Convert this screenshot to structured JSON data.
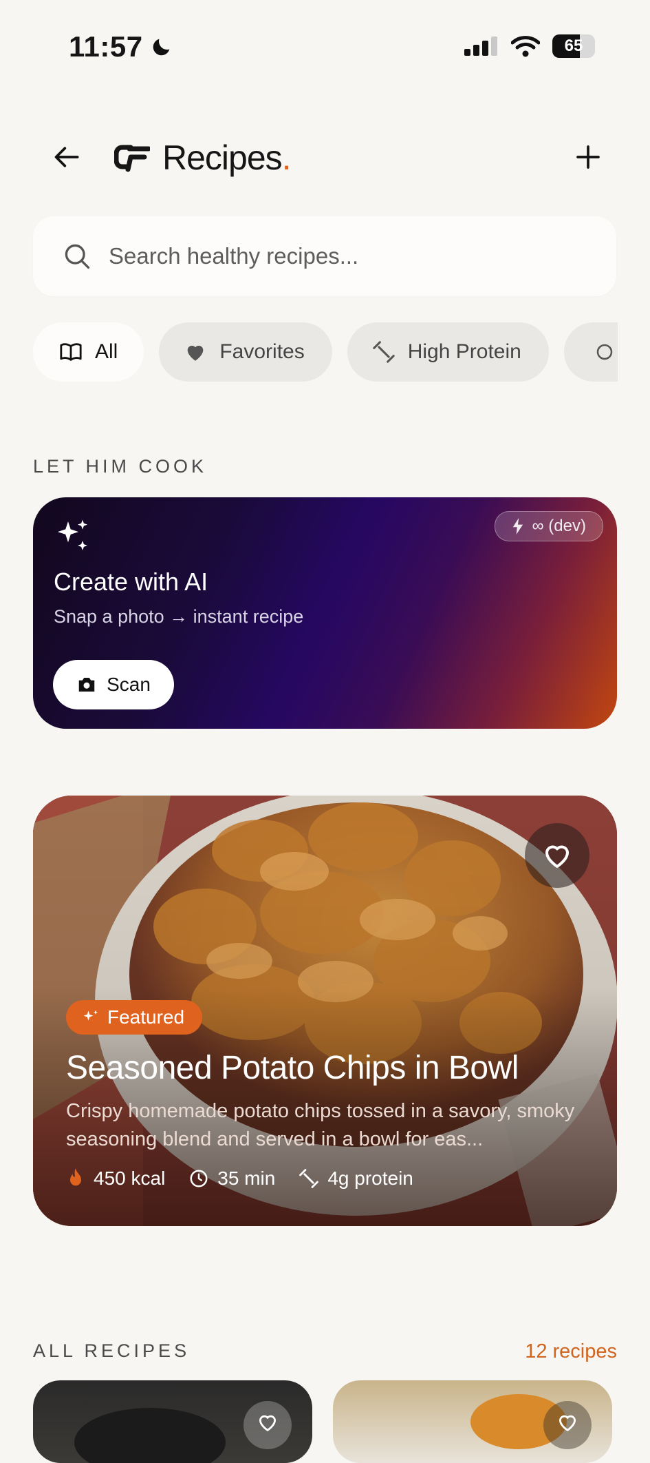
{
  "status": {
    "time": "11:57",
    "battery": "65"
  },
  "header": {
    "title": "Recipes",
    "title_dot": "."
  },
  "search": {
    "placeholder": "Search healthy recipes..."
  },
  "filters": [
    {
      "label": "All",
      "icon": "book-open-icon",
      "active": true
    },
    {
      "label": "Favorites",
      "icon": "heart-icon",
      "active": false
    },
    {
      "label": "High Protein",
      "icon": "dumbbell-icon",
      "active": false
    }
  ],
  "sections": {
    "cook": "LET HIM COOK",
    "all": "ALL RECIPES",
    "count": "12 recipes"
  },
  "ai_card": {
    "title": "Create with AI",
    "subtitle": "Snap a photo → instant recipe",
    "button": "Scan",
    "quota": "∞ (dev)"
  },
  "featured": {
    "badge": "Featured",
    "title": "Seasoned Potato Chips in Bowl",
    "description": "Crispy homemade potato chips tossed in a savory, smoky seasoning blend and served in a bowl for eas...",
    "kcal": "450 kcal",
    "time": "35 min",
    "protein": "4g protein"
  },
  "colors": {
    "accent": "#E0621F",
    "background": "#F7F6F3"
  }
}
